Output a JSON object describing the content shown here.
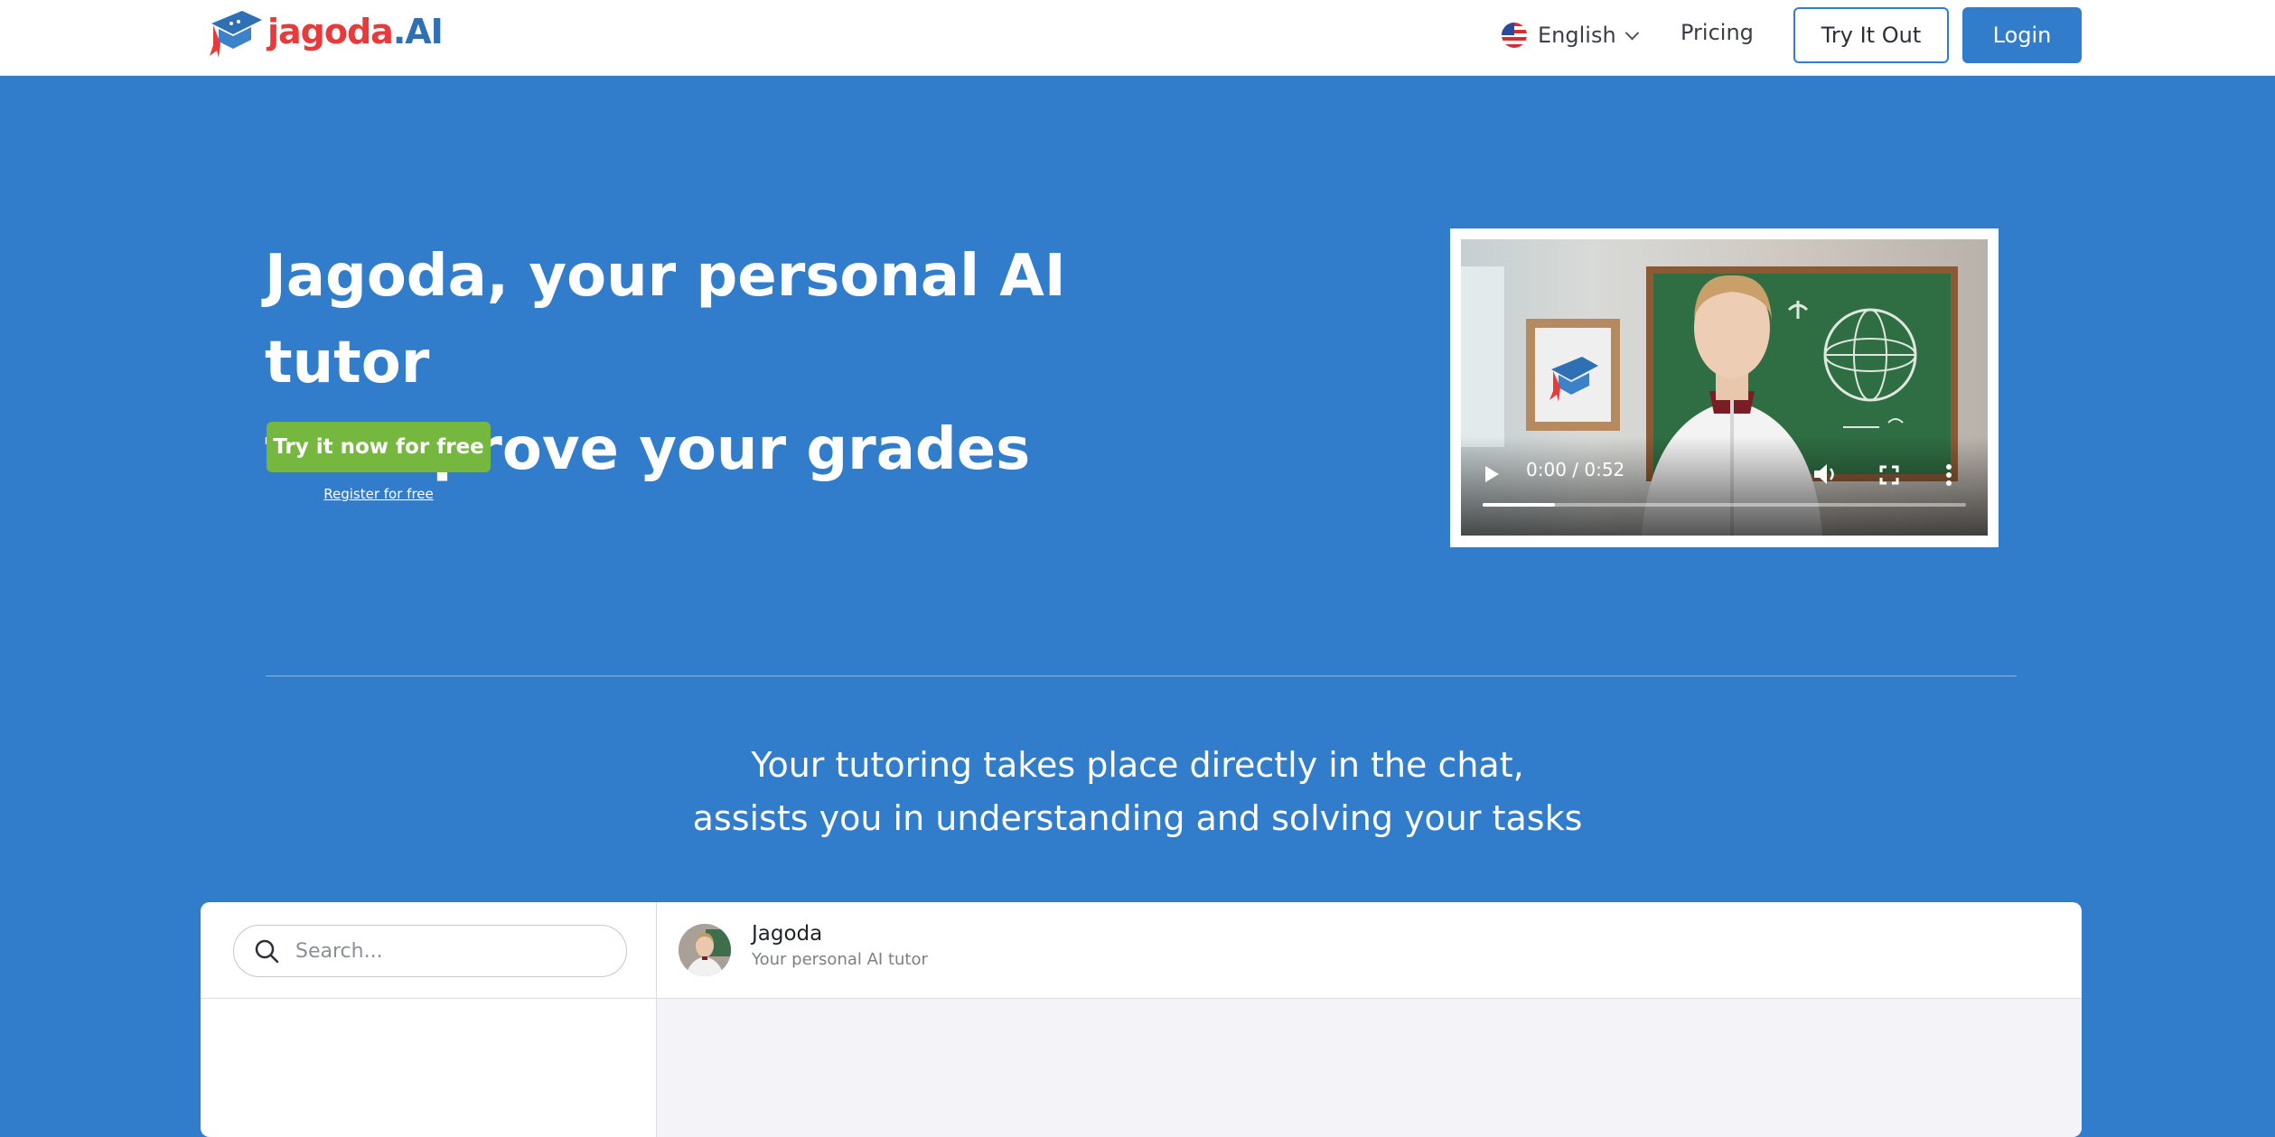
{
  "nav": {
    "logo": {
      "text_main": "jagoda",
      "text_suffix": ".AI"
    },
    "language": {
      "label": "English",
      "flag_icon": "us-flag-icon"
    },
    "pricing_label": "Pricing",
    "try_label": "Try It Out",
    "login_label": "Login"
  },
  "hero": {
    "title_line1": "Jagoda, your personal AI tutor",
    "title_line2": "to improve your grades",
    "cta_label": "Try it now for free",
    "register_label": "Register for free"
  },
  "video": {
    "time": "0:00 / 0:52",
    "progress": 0.15
  },
  "subheading": {
    "line1": "Your tutoring takes place directly in the chat,",
    "line2": "assists you in understanding and solving your tasks"
  },
  "chat": {
    "search_placeholder": "Search...",
    "contact_name": "Jagoda",
    "contact_role": "Your personal AI tutor"
  },
  "colors": {
    "primary": "#317dcb",
    "cta_green": "#76b73f",
    "logo_red": "#e8393b",
    "logo_blue": "#2f6fb3"
  }
}
